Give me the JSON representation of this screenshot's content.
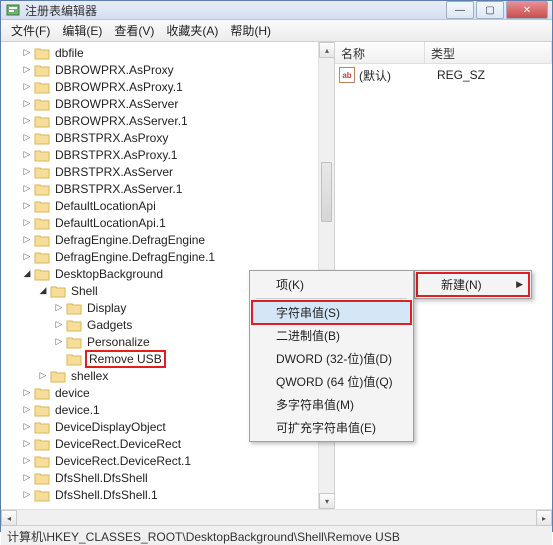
{
  "window": {
    "title": "注册表编辑器"
  },
  "titlebar_controls": {
    "min": "—",
    "max": "▢",
    "close": "✕"
  },
  "menus": {
    "file": "文件(F)",
    "edit": "编辑(E)",
    "view": "查看(V)",
    "favorites": "收藏夹(A)",
    "help": "帮助(H)"
  },
  "tree": [
    {
      "label": "dbfile",
      "depth": 1,
      "exp": "closed"
    },
    {
      "label": "DBROWPRX.AsProxy",
      "depth": 1,
      "exp": "closed"
    },
    {
      "label": "DBROWPRX.AsProxy.1",
      "depth": 1,
      "exp": "closed"
    },
    {
      "label": "DBROWPRX.AsServer",
      "depth": 1,
      "exp": "closed"
    },
    {
      "label": "DBROWPRX.AsServer.1",
      "depth": 1,
      "exp": "closed"
    },
    {
      "label": "DBRSTPRX.AsProxy",
      "depth": 1,
      "exp": "closed"
    },
    {
      "label": "DBRSTPRX.AsProxy.1",
      "depth": 1,
      "exp": "closed"
    },
    {
      "label": "DBRSTPRX.AsServer",
      "depth": 1,
      "exp": "closed"
    },
    {
      "label": "DBRSTPRX.AsServer.1",
      "depth": 1,
      "exp": "closed"
    },
    {
      "label": "DefaultLocationApi",
      "depth": 1,
      "exp": "closed"
    },
    {
      "label": "DefaultLocationApi.1",
      "depth": 1,
      "exp": "closed"
    },
    {
      "label": "DefragEngine.DefragEngine",
      "depth": 1,
      "exp": "closed"
    },
    {
      "label": "DefragEngine.DefragEngine.1",
      "depth": 1,
      "exp": "closed"
    },
    {
      "label": "DesktopBackground",
      "depth": 1,
      "exp": "open"
    },
    {
      "label": "Shell",
      "depth": 2,
      "exp": "open"
    },
    {
      "label": "Display",
      "depth": 3,
      "exp": "closed"
    },
    {
      "label": "Gadgets",
      "depth": 3,
      "exp": "closed"
    },
    {
      "label": "Personalize",
      "depth": 3,
      "exp": "closed"
    },
    {
      "label": "Remove USB",
      "depth": 3,
      "exp": "none",
      "highlight": true
    },
    {
      "label": "shellex",
      "depth": 2,
      "exp": "closed"
    },
    {
      "label": "device",
      "depth": 1,
      "exp": "closed"
    },
    {
      "label": "device.1",
      "depth": 1,
      "exp": "closed"
    },
    {
      "label": "DeviceDisplayObject",
      "depth": 1,
      "exp": "closed"
    },
    {
      "label": "DeviceRect.DeviceRect",
      "depth": 1,
      "exp": "closed"
    },
    {
      "label": "DeviceRect.DeviceRect.1",
      "depth": 1,
      "exp": "closed"
    },
    {
      "label": "DfsShell.DfsShell",
      "depth": 1,
      "exp": "closed"
    },
    {
      "label": "DfsShell.DfsShell.1",
      "depth": 1,
      "exp": "closed"
    }
  ],
  "right": {
    "headers": {
      "name": "名称",
      "type": "类型"
    },
    "rows": [
      {
        "name": "(默认)",
        "type": "REG_SZ",
        "icon": "ab"
      }
    ]
  },
  "context_main": {
    "items": [
      {
        "label": "项(K)"
      },
      {
        "label": "字符串值(S)",
        "highlight": true,
        "hover": true
      },
      {
        "label": "二进制值(B)"
      },
      {
        "label": "DWORD (32-位)值(D)"
      },
      {
        "label": "QWORD (64 位)值(Q)"
      },
      {
        "label": "多字符串值(M)"
      },
      {
        "label": "可扩充字符串值(E)"
      }
    ]
  },
  "context_sub": {
    "items": [
      {
        "label": "新建(N)",
        "submenu": true,
        "highlight": true
      }
    ]
  },
  "statusbar": "计算机\\HKEY_CLASSES_ROOT\\DesktopBackground\\Shell\\Remove USB"
}
